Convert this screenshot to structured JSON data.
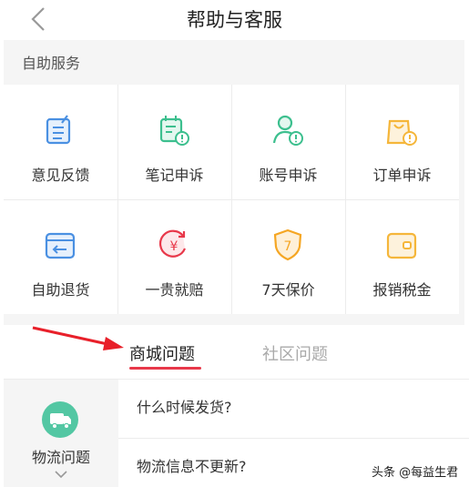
{
  "header": {
    "title": "帮助与客服",
    "back_icon": "chevron-left-icon"
  },
  "self_service": {
    "title": "自助服务",
    "items": [
      {
        "label": "意见反馈",
        "icon": "feedback-icon",
        "color": "#4a90e2"
      },
      {
        "label": "笔记申诉",
        "icon": "note-appeal-icon",
        "color": "#3cbf8e"
      },
      {
        "label": "账号申诉",
        "icon": "account-appeal-icon",
        "color": "#3cbf8e"
      },
      {
        "label": "订单申诉",
        "icon": "order-appeal-icon",
        "color": "#f5b63a"
      },
      {
        "label": "自助退货",
        "icon": "return-box-icon",
        "color": "#4a90e2"
      },
      {
        "label": "一贵就赔",
        "icon": "price-compensation-icon",
        "color": "#e8384a"
      },
      {
        "label": "7天保价",
        "icon": "price-protect-shield-icon",
        "color": "#f5a623"
      },
      {
        "label": "报销税金",
        "icon": "wallet-icon",
        "color": "#f5b63a"
      }
    ]
  },
  "tabs": [
    {
      "label": "商城问题",
      "active": true
    },
    {
      "label": "社区问题",
      "active": false
    }
  ],
  "accent_color": "#e8384a",
  "categories": [
    {
      "label": "物流问题",
      "icon": "truck-icon",
      "color": "#53c7a3"
    }
  ],
  "questions": [
    {
      "label": "什么时候发货?"
    },
    {
      "label": "物流信息不更新?"
    }
  ],
  "watermark": "头条 @每益生君"
}
